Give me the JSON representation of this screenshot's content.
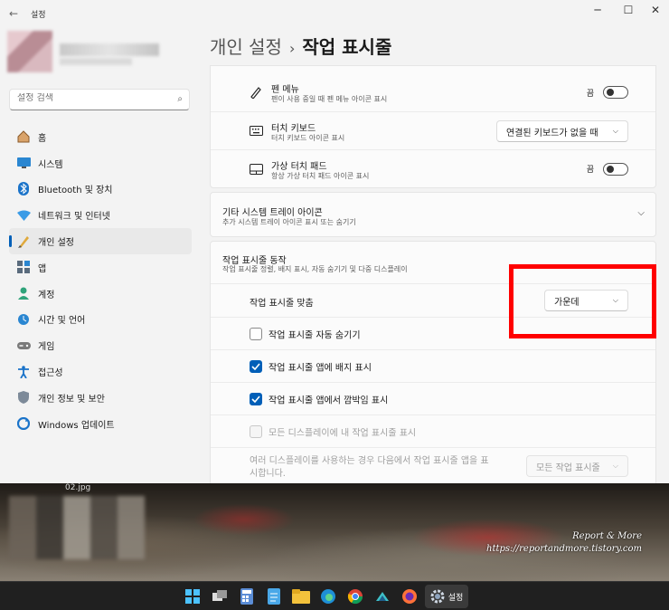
{
  "window": {
    "app_title": "설정",
    "back": "←",
    "minimize": "─",
    "maximize": "☐",
    "close": "✕"
  },
  "search": {
    "placeholder": "설정 검색"
  },
  "nav": [
    {
      "label": "홈",
      "icon": "home-icon"
    },
    {
      "label": "시스템",
      "icon": "system-icon"
    },
    {
      "label": "Bluetooth 및 장치",
      "icon": "bluetooth-icon"
    },
    {
      "label": "네트워크 및 인터넷",
      "icon": "network-icon"
    },
    {
      "label": "개인 설정",
      "icon": "personalization-icon",
      "active": true
    },
    {
      "label": "앱",
      "icon": "apps-icon"
    },
    {
      "label": "계정",
      "icon": "account-icon"
    },
    {
      "label": "시간 및 언어",
      "icon": "time-language-icon"
    },
    {
      "label": "게임",
      "icon": "gaming-icon"
    },
    {
      "label": "접근성",
      "icon": "accessibility-icon"
    },
    {
      "label": "개인 정보 및 보안",
      "icon": "privacy-icon"
    },
    {
      "label": "Windows 업데이트",
      "icon": "update-icon"
    }
  ],
  "breadcrumb": {
    "parent": "개인 설정",
    "separator": "›",
    "current": "작업 표시줄"
  },
  "tray": {
    "pen": {
      "title": "펜 메뉴",
      "subtitle": "펜이 사용 중일 때 펜 메뉴 아이콘 표시",
      "state": "끔"
    },
    "touch_keyboard": {
      "title": "터치 키보드",
      "subtitle": "터치 키보드 아이콘 표시",
      "value": "연결된 키보드가 없을 때"
    },
    "touchpad": {
      "title": "가상 터치 패드",
      "subtitle": "항상 가상 터치 패드 아이콘 표시",
      "state": "끔"
    }
  },
  "other_tray": {
    "title": "기타 시스템 트레이 아이콘",
    "subtitle": "추가 시스템 트레이 아이콘 표시 또는 숨기기"
  },
  "behaviors": {
    "title": "작업 표시줄 동작",
    "subtitle": "작업 표시줄 정렬, 배지 표시, 자동 숨기기 및 다중 디스플레이",
    "alignment_label": "작업 표시줄 맞춤",
    "alignment_value": "가운데",
    "auto_hide": {
      "label": "작업 표시줄 자동 숨기기",
      "checked": false
    },
    "badges": {
      "label": "작업 표시줄 앱에 배지 표시",
      "checked": true
    },
    "flashing": {
      "label": "작업 표시줄 앱에서 깜박임 표시",
      "checked": true
    },
    "all_displays": {
      "label": "모든 디스플레이에 내 작업 표시줄 표시",
      "checked": false,
      "disabled": true
    },
    "multi_display_text": "여러 디스플레이를 사용하는 경우 다음에서 작업 표시줄 앱을 표시합니다.",
    "multi_display_value": "모든 작업 표시줄"
  },
  "wallpaper": {
    "filename": "02.jpg",
    "watermark_line1": "Report & More",
    "watermark_line2": "https://reportandmore.tistory.com"
  },
  "taskbar": {
    "apps": [
      "windows-start-icon",
      "task-view-icon",
      "calculator-icon",
      "notepad-icon",
      "file-explorer-icon",
      "edge-icon",
      "chrome-icon",
      "xbox-icon",
      "firefox-icon",
      "settings-icon"
    ],
    "settings_label": "설정"
  },
  "colors": {
    "accent": "#005fb8",
    "highlight": "#ff0000"
  }
}
